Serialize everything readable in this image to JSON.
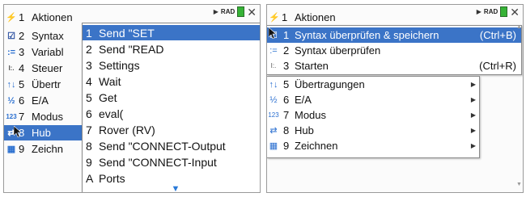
{
  "left": {
    "status": {
      "mode": "RAD"
    },
    "items": [
      {
        "icon": "⚡",
        "num": "1",
        "label": "Aktionen"
      },
      {
        "icon": "☑",
        "num": "2",
        "label": "Syntax"
      },
      {
        "icon": ":=",
        "num": "3",
        "label": "Variabl"
      },
      {
        "icon": "I:.",
        "num": "4",
        "label": "Steuer"
      },
      {
        "icon": "↑↓",
        "num": "5",
        "label": "Übertr"
      },
      {
        "icon": "½",
        "num": "6",
        "label": "E/A"
      },
      {
        "icon": "123",
        "num": "7",
        "label": "Modus"
      },
      {
        "icon": "⇄",
        "num": "8",
        "label": "Hub"
      },
      {
        "icon": "▦",
        "num": "9",
        "label": "Zeichn"
      }
    ],
    "menu": [
      {
        "key": "1",
        "label": "Send \"SET"
      },
      {
        "key": "2",
        "label": "Send \"READ"
      },
      {
        "key": "3",
        "label": "Settings"
      },
      {
        "key": "4",
        "label": "Wait"
      },
      {
        "key": "5",
        "label": "Get"
      },
      {
        "key": "6",
        "label": "eval("
      },
      {
        "key": "7",
        "label": "Rover (RV)"
      },
      {
        "key": "8",
        "label": "Send \"CONNECT-Output"
      },
      {
        "key": "9",
        "label": "Send \"CONNECT-Input"
      },
      {
        "key": "A",
        "label": "Ports"
      }
    ],
    "more_indicator": "▼"
  },
  "right": {
    "status": {
      "mode": "RAD"
    },
    "items": [
      {
        "icon": "⚡",
        "num": "1",
        "label": "Aktionen"
      },
      {
        "icon": "☑",
        "num": "1",
        "label": "Syntax überprüfen & speichern",
        "shortcut": "(Ctrl+B)"
      },
      {
        "icon": ":=",
        "num": "2",
        "label": "Syntax überprüfen"
      },
      {
        "icon": "I:.",
        "num": "3",
        "label": "Starten",
        "shortcut": "(Ctrl+R)"
      },
      {
        "icon": "↑↓",
        "num": "5",
        "label": "Übertragungen"
      },
      {
        "icon": "½",
        "num": "6",
        "label": "E/A"
      },
      {
        "icon": "123",
        "num": "7",
        "label": "Modus"
      },
      {
        "icon": "⇄",
        "num": "8",
        "label": "Hub"
      },
      {
        "icon": "▦",
        "num": "9",
        "label": "Zeichnen"
      }
    ]
  }
}
